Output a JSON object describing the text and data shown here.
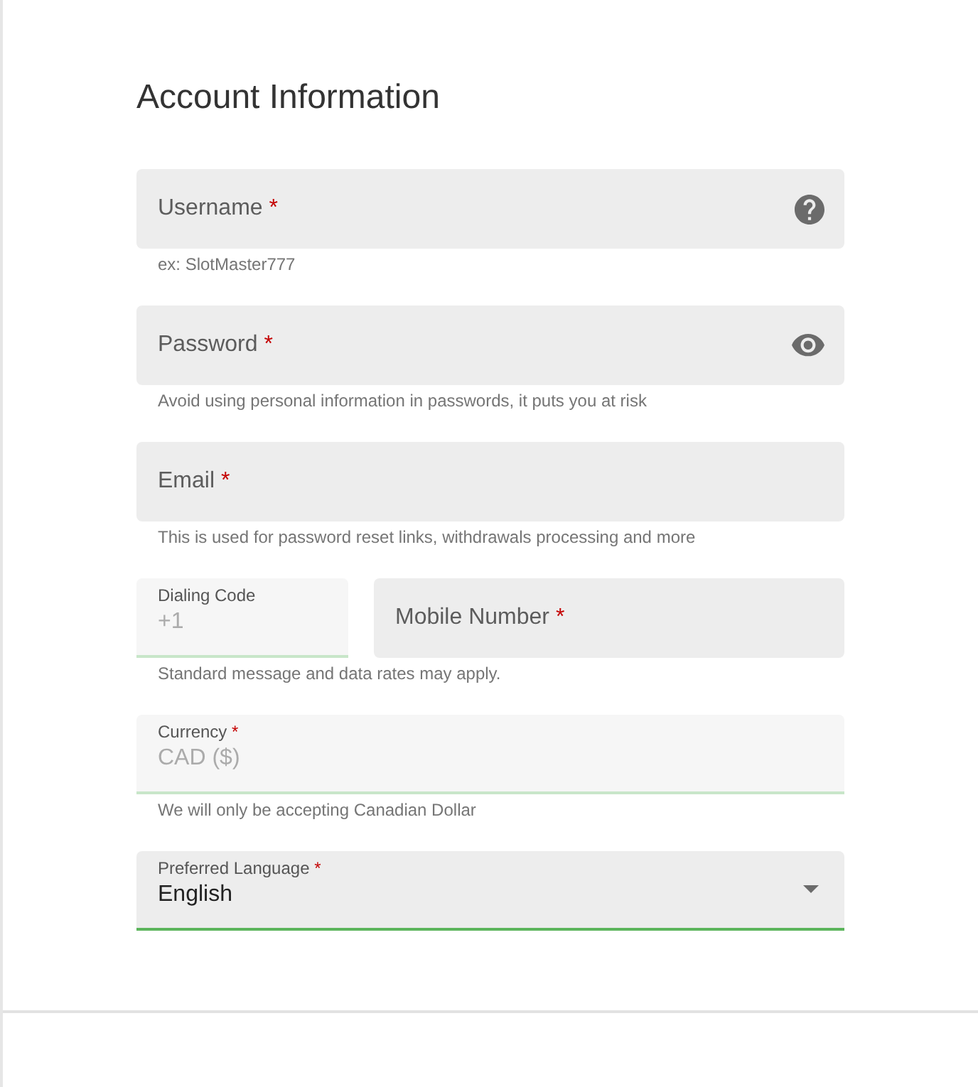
{
  "title": "Account Information",
  "rows": [
    {
      "fields": [
        {
          "kind": "help",
          "label": "Username",
          "mark": "*",
          "disabled": false,
          "focused": false
        }
      ],
      "hint": "ex: SlotMaster777"
    },
    {
      "fields": [
        {
          "kind": "password",
          "label": "Password",
          "mark": "*",
          "disabled": false,
          "focused": false
        }
      ],
      "hint": "Avoid using personal information in passwords, it puts you at risk"
    },
    {
      "fields": [
        {
          "kind": "text",
          "label": "Email",
          "mark": "*",
          "disabled": false,
          "focused": false
        }
      ],
      "hint": "This is used for password reset links, withdrawals processing and more"
    },
    {
      "fields": [
        {
          "kind": "text",
          "label": "Dialing Code",
          "value": "+1",
          "disabled": true,
          "focused": false
        },
        {
          "kind": "text",
          "label": "Mobile Number",
          "mark": "*",
          "disabled": false,
          "focused": false
        }
      ],
      "hint": "Standard message and data rates may apply."
    },
    {
      "fields": [
        {
          "kind": "text",
          "label": "Currency",
          "mark": "*",
          "value": "CAD ($)",
          "disabled": true,
          "focused": false
        }
      ],
      "hint": "We will only be accepting Canadian Dollar"
    },
    {
      "fields": [
        {
          "kind": "select",
          "label": "Preferred Language",
          "mark": "*",
          "value": "English",
          "disabled": false,
          "focused": true
        }
      ]
    }
  ]
}
